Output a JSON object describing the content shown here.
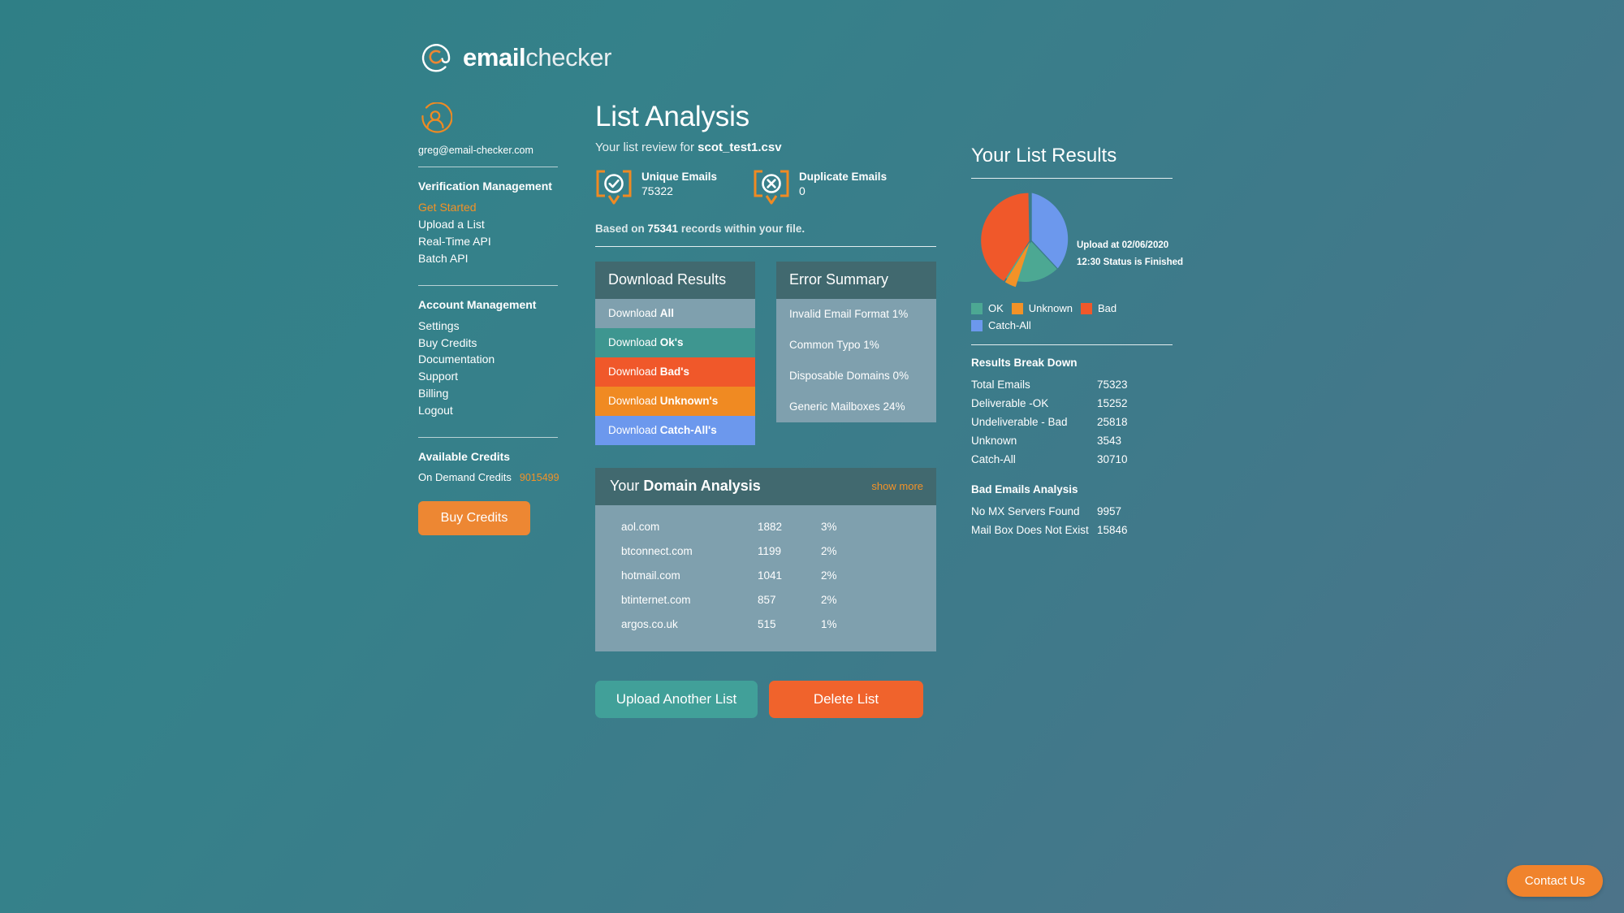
{
  "brand": {
    "name_bold": "email",
    "name_light": "checker",
    "logo_icon": "at-sign-circle-icon"
  },
  "sidebar": {
    "avatar_icon": "user-avatar-icon",
    "user_email": "greg@email-checker.com",
    "sections": [
      {
        "heading": "Verification Management",
        "items": [
          {
            "label": "Get Started",
            "active": true
          },
          {
            "label": "Upload a List",
            "active": false
          },
          {
            "label": "Real-Time API",
            "active": false
          },
          {
            "label": "Batch API",
            "active": false
          }
        ]
      },
      {
        "heading": "Account Management",
        "items": [
          {
            "label": "Settings",
            "active": false
          },
          {
            "label": "Buy Credits",
            "active": false
          },
          {
            "label": "Documentation",
            "active": false
          },
          {
            "label": "Support",
            "active": false
          },
          {
            "label": "Billing",
            "active": false
          },
          {
            "label": "Logout",
            "active": false
          }
        ]
      }
    ],
    "credits_heading": "Available Credits",
    "credits_label": "On Demand Credits",
    "credits_value": "9015499",
    "buy_credits_label": "Buy Credits"
  },
  "main": {
    "title": "List Analysis",
    "subtitle_prefix": "Your list review for ",
    "subtitle_file": "scot_test1.csv",
    "stats": [
      {
        "icon": "check-bubble-icon",
        "label": "Unique Emails",
        "value": "75322"
      },
      {
        "icon": "cross-bubble-icon",
        "label": "Duplicate Emails",
        "value": "0"
      }
    ],
    "based_on_prefix": "Based on ",
    "based_on_value": "75341",
    "based_on_suffix": " records within your file.",
    "download_panel": {
      "title": "Download Results",
      "rows": [
        {
          "prefix": "Download ",
          "name": "All"
        },
        {
          "prefix": "Download ",
          "name": "Ok's"
        },
        {
          "prefix": "Download ",
          "name": "Bad's"
        },
        {
          "prefix": "Download ",
          "name": "Unknown's"
        },
        {
          "prefix": "Download ",
          "name": "Catch-All's"
        }
      ]
    },
    "error_panel": {
      "title": "Error Summary",
      "rows": [
        "Invalid Email Format 1%",
        "Common Typo 1%",
        "Disposable Domains 0%",
        "Generic Mailboxes 24%"
      ]
    },
    "domain_panel": {
      "title_light": "Your ",
      "title_bold": "Domain Analysis",
      "show_more": "show more",
      "rows": [
        {
          "domain": "aol.com",
          "count": "1882",
          "pct": "3%"
        },
        {
          "domain": "btconnect.com",
          "count": "1199",
          "pct": "2%"
        },
        {
          "domain": "hotmail.com",
          "count": "1041",
          "pct": "2%"
        },
        {
          "domain": "btinternet.com",
          "count": "857",
          "pct": "2%"
        },
        {
          "domain": "argos.co.uk",
          "count": "515",
          "pct": "1%"
        }
      ]
    },
    "upload_another_label": "Upload Another List",
    "delete_list_label": "Delete List"
  },
  "right": {
    "title": "Your List Results",
    "upload_date_line": "Upload at 02/06/2020",
    "status_line": "12:30 Status is Finished",
    "legend": [
      {
        "label": "OK",
        "color": "#4CA893"
      },
      {
        "label": "Unknown",
        "color": "#F39227"
      },
      {
        "label": "Bad",
        "color": "#F0582A"
      },
      {
        "label": "Catch-All",
        "color": "#6C98ED"
      }
    ],
    "breakdown_heading": "Results Break Down",
    "breakdown": [
      {
        "key": "Total Emails",
        "value": "75323"
      },
      {
        "key": "Deliverable -OK",
        "value": "15252"
      },
      {
        "key": "Undeliverable - Bad",
        "value": "25818"
      },
      {
        "key": "Unknown",
        "value": "3543"
      },
      {
        "key": "Catch-All",
        "value": "30710"
      }
    ],
    "bad_heading": "Bad Emails Analysis",
    "bad_rows": [
      {
        "key": "No MX Servers Found",
        "value": "9957"
      },
      {
        "key": "Mail Box Does Not Exist",
        "value": "15846"
      }
    ]
  },
  "contact": {
    "label": "Contact Us"
  },
  "chart_data": {
    "type": "pie",
    "title": "Your List Results",
    "labels": [
      "Catch-All",
      "OK",
      "Unknown",
      "Bad"
    ],
    "values": [
      30710,
      15252,
      3543,
      25818
    ],
    "percentages": [
      40.8,
      20.2,
      4.7,
      34.3
    ],
    "colors": [
      "#6C98ED",
      "#4CA893",
      "#F39227",
      "#F0582A"
    ],
    "legend_position": "bottom",
    "total": 75323,
    "annotations": [
      "Upload at 02/06/2020",
      "12:30 Status is Finished"
    ]
  }
}
